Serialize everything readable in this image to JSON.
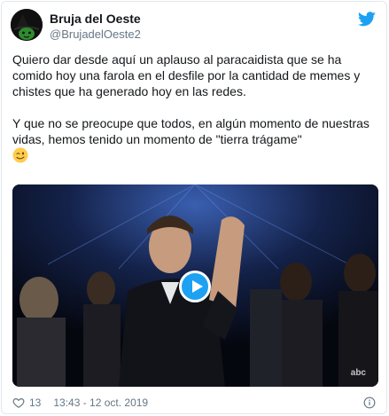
{
  "author": {
    "display_name": "Bruja del Oeste",
    "handle": "@BrujadelOeste2",
    "avatar_icon": "witch-avatar-icon"
  },
  "brand_icon": "twitter-bird-icon",
  "tweet": {
    "paragraph_1": "Quiero dar desde aquí un aplauso al paracaidista que se ha comido hoy una farola en el desfile por la cantidad de memes y chistes que ha generado hoy en las redes.",
    "paragraph_2": "Y que no se preocupe que todos, en algún momento de nuestras vidas, hemos tenido un momento de \"tierra trágame\"",
    "emoji": "winking-face"
  },
  "media": {
    "type": "video",
    "play_icon": "play-icon",
    "watermark": "abc"
  },
  "footer": {
    "likes": "13",
    "timestamp": "13:43 - 12 oct. 2019",
    "heart_icon": "heart-icon",
    "info_icon": "info-icon"
  },
  "colors": {
    "accent": "#1da1f2",
    "text": "#14171a",
    "secondary_text": "#657786",
    "border": "#e1e8ed"
  }
}
